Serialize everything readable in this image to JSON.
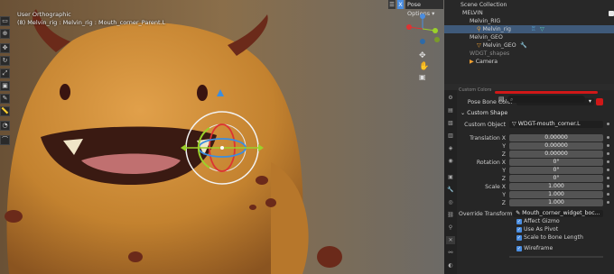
{
  "viewport": {
    "view_name": "User Orthographic",
    "context": "(8) Melvin_rig : Melvin_rig : Mouth_corner_Parent.L",
    "pose_options": "Pose Options",
    "x_label": "X",
    "mode_icon": "cursor-icon"
  },
  "outliner": {
    "rows": [
      {
        "label": "Scene Collection"
      },
      {
        "label": "MELVIN"
      },
      {
        "label": "Melvin_RIG"
      },
      {
        "label": "Melvin_rig"
      },
      {
        "label": "Melvin_GEO"
      },
      {
        "label": "Melvin_GEO"
      },
      {
        "label": "WDGT_shapes"
      },
      {
        "label": "Camera"
      }
    ]
  },
  "properties": {
    "cut_label": "Custom Colors",
    "pose_bone_color_label": "Pose Bone Color",
    "pose_bone_color_value": "Default Colors",
    "custom_shape_header": "Custom Shape",
    "custom_object_label": "Custom Object",
    "custom_object_value": "WDGT-mouth_corner.L",
    "translation_label": "Translation X",
    "translation": [
      "0.00000",
      "0.00000",
      "0.00000"
    ],
    "rotation_label": "Rotation X",
    "rotation": [
      "0°",
      "0°",
      "0°"
    ],
    "scale_label": "Scale X",
    "scale": [
      "1.000",
      "1.000",
      "1.000"
    ],
    "y_label": "Y",
    "z_label": "Z",
    "override_label": "Override Transform",
    "override_value": "Mouth_corner_widget_boc...",
    "affect_gizmo": "Affect Gizmo",
    "use_as_pivot": "Use As Pivot",
    "scale_to_bone": "Scale to Bone Length",
    "wireframe": "Wireframe"
  },
  "colors": {
    "accent": "#4a8de0",
    "selected_row": "#3f5a7a",
    "character_skin": "#c98a3a",
    "red_bar": "#d01818"
  }
}
